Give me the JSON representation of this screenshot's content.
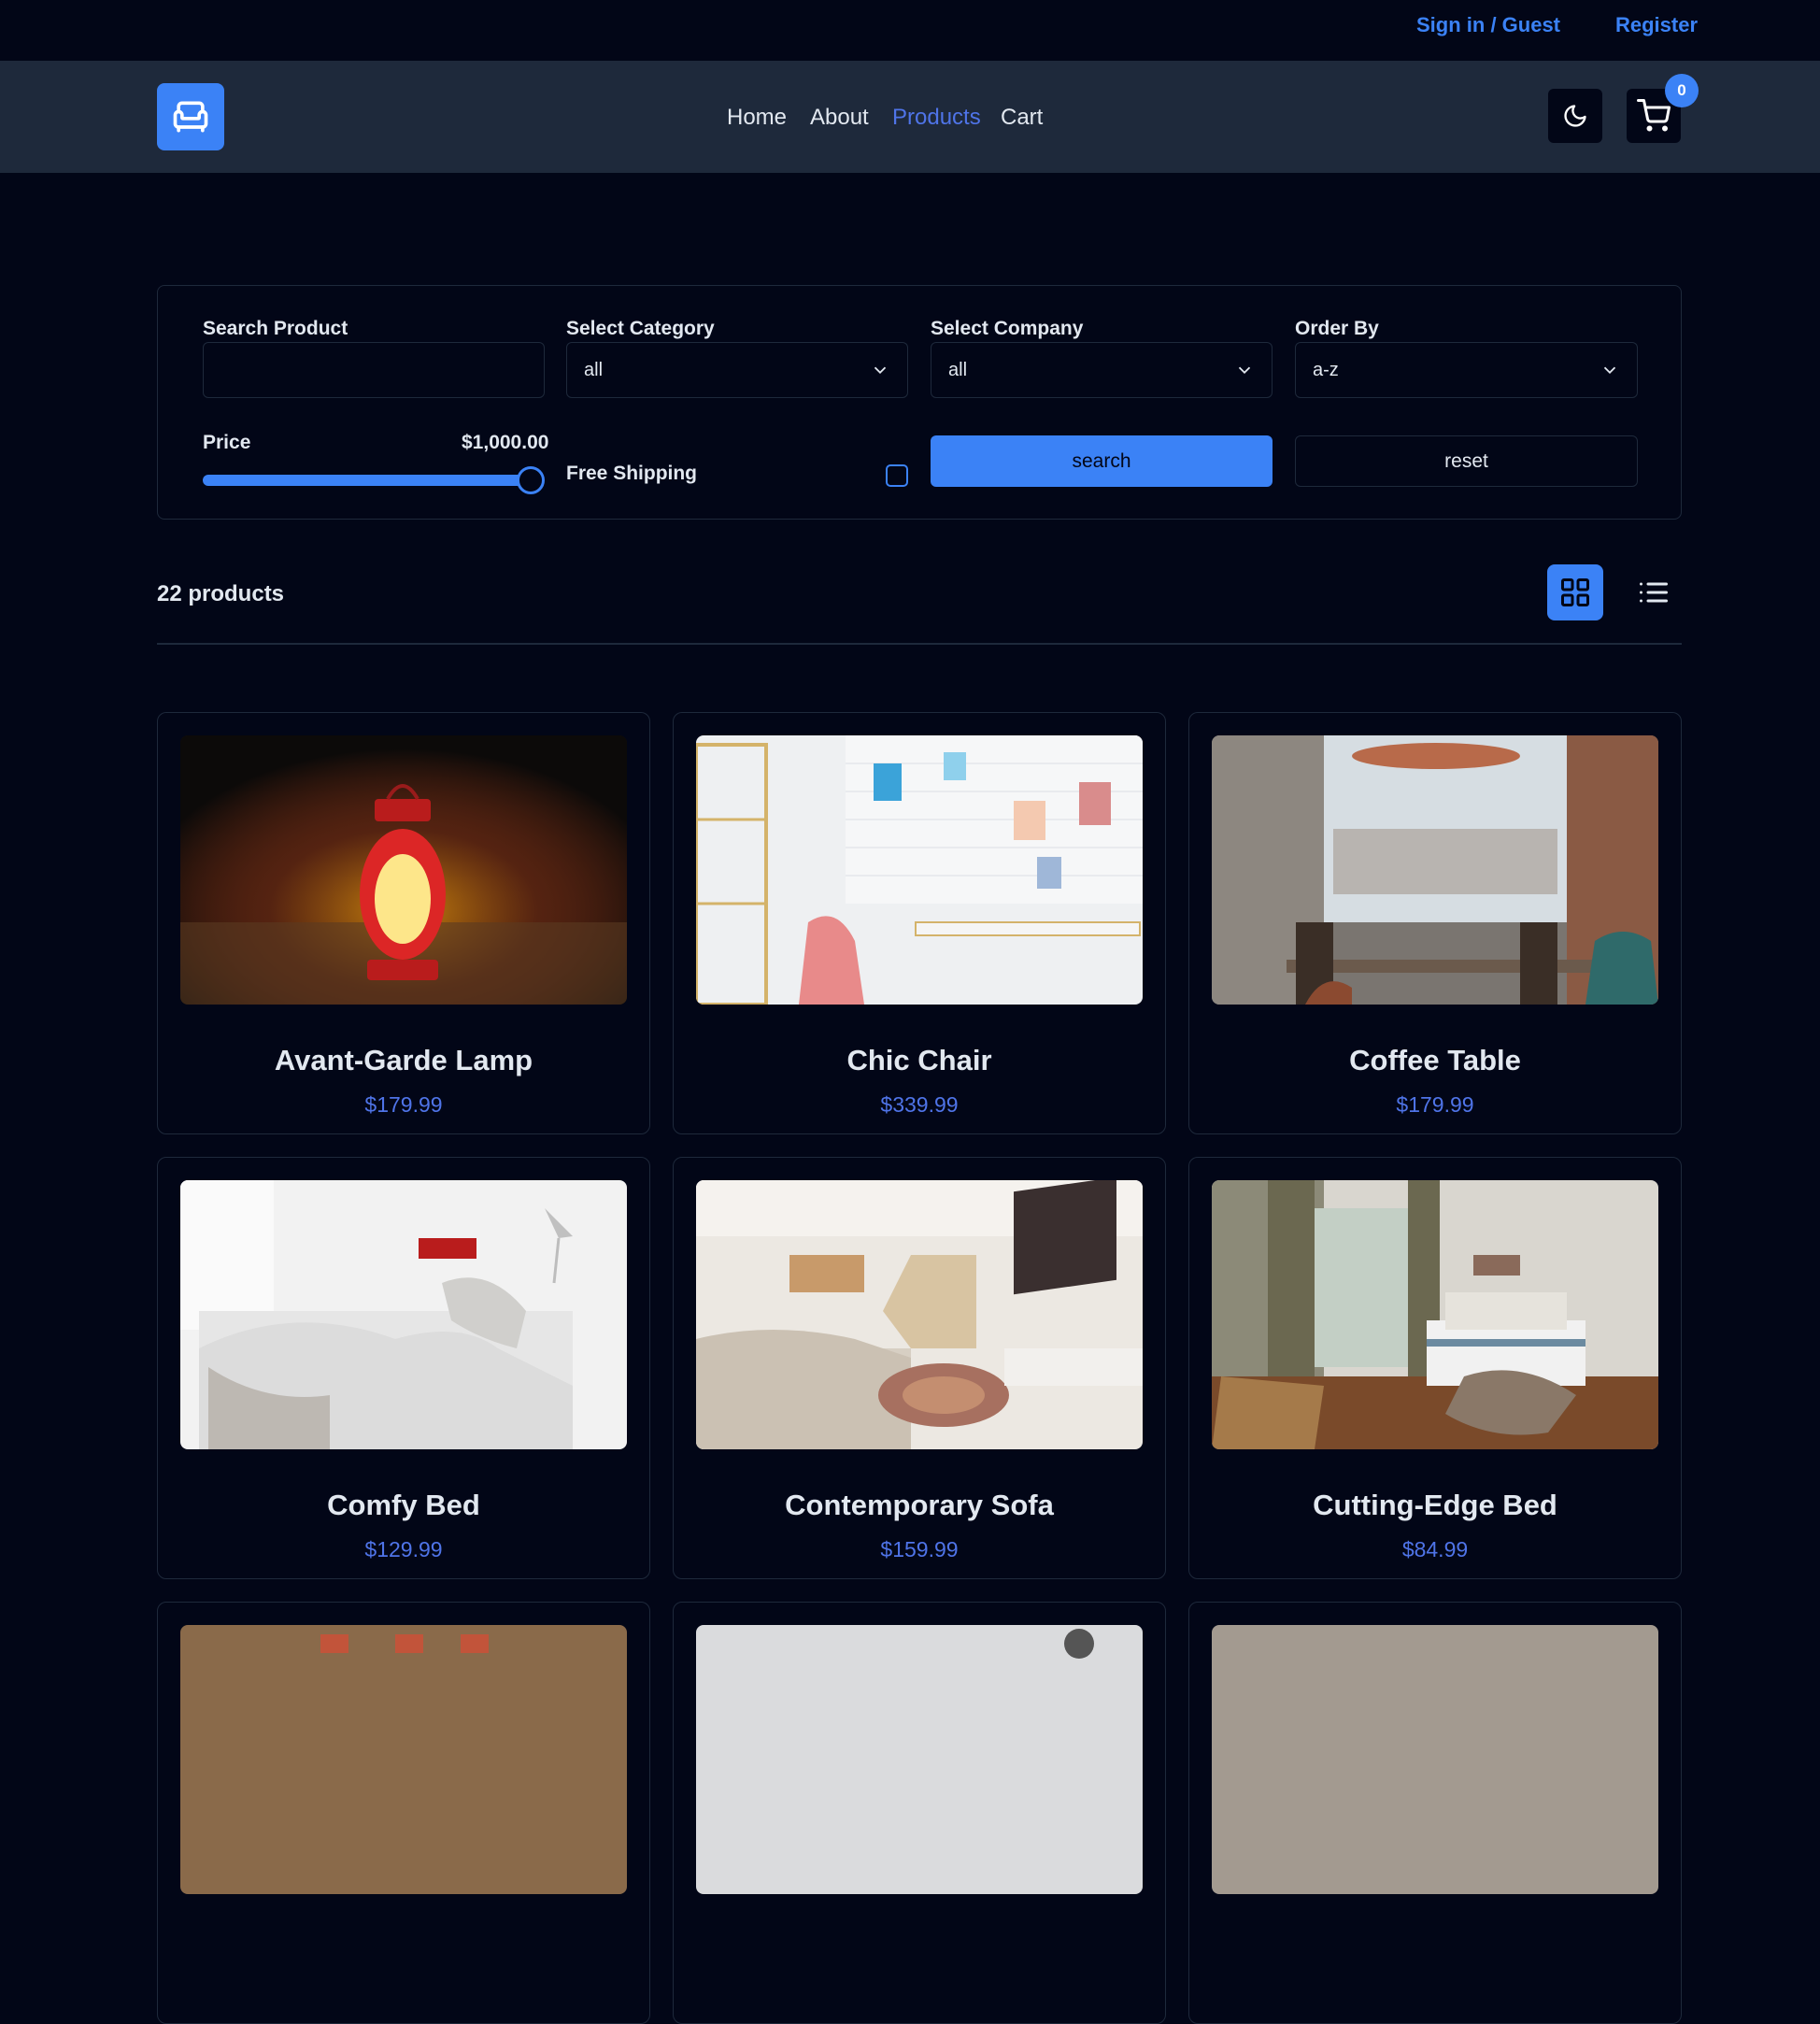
{
  "topbar": {
    "signin": "Sign in / Guest",
    "register": "Register"
  },
  "nav": {
    "links": [
      "Home",
      "About",
      "Products",
      "Cart"
    ],
    "active": "Products",
    "cart_count": "0",
    "logo_icon": "armchair-icon",
    "theme_icon": "moon-icon",
    "cart_icon": "cart-icon"
  },
  "filters": {
    "search_label": "Search Product",
    "search_value": "",
    "category_label": "Select Category",
    "category_value": "all",
    "company_label": "Select Company",
    "company_value": "all",
    "order_label": "Order By",
    "order_value": "a-z",
    "price_label": "Price",
    "price_value": "$1,000.00",
    "price_fraction": 1.0,
    "shipping_label": "Free Shipping",
    "shipping_checked": false,
    "search_button": "search",
    "reset_button": "reset"
  },
  "products_header": {
    "count": "22 products",
    "active_view": "grid"
  },
  "products": [
    {
      "title": "Avant-Garde Lamp",
      "price": "$179.99"
    },
    {
      "title": "Chic Chair",
      "price": "$339.99"
    },
    {
      "title": "Coffee Table",
      "price": "$179.99"
    },
    {
      "title": "Comfy Bed",
      "price": "$129.99"
    },
    {
      "title": "Contemporary Sofa",
      "price": "$159.99"
    },
    {
      "title": "Cutting-Edge Bed",
      "price": "$84.99"
    }
  ],
  "colors": {
    "accent": "#3b82f6",
    "price": "#4f74e8",
    "background": "#020617",
    "navbar": "#1e293b"
  }
}
